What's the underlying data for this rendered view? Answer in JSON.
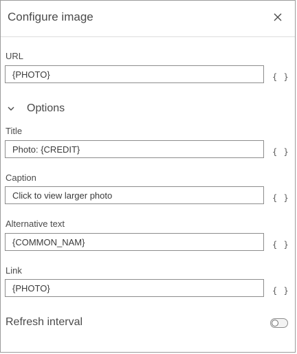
{
  "header": {
    "title": "Configure image",
    "close_icon": "close-icon"
  },
  "url": {
    "label": "URL",
    "value": "{PHOTO}",
    "expression_button": "{ }"
  },
  "options": {
    "label": "Options",
    "icon": "chevron-down-icon"
  },
  "title_field": {
    "label": "Title",
    "value": "Photo: {CREDIT}",
    "expression_button": "{ }"
  },
  "caption": {
    "label": "Caption",
    "value": "Click to view larger photo",
    "expression_button": "{ }"
  },
  "alt_text": {
    "label": "Alternative text",
    "value": "{COMMON_NAM}",
    "expression_button": "{ }"
  },
  "link": {
    "label": "Link",
    "value": "{PHOTO}",
    "expression_button": "{ }"
  },
  "refresh": {
    "label": "Refresh interval",
    "enabled": false
  }
}
